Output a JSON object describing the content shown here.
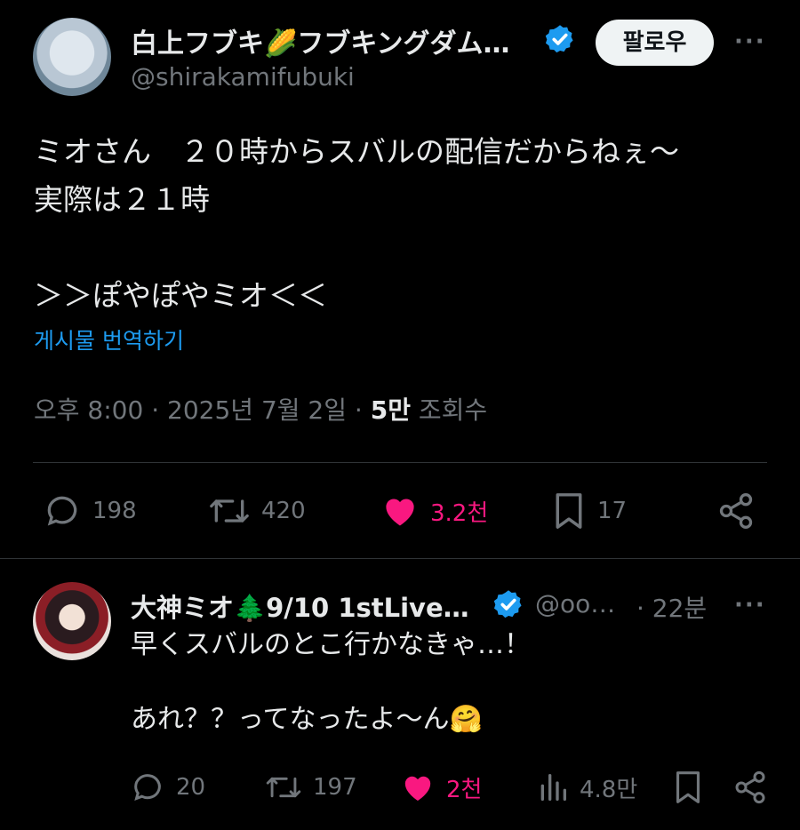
{
  "post": {
    "author_name": "白上フブキ🌽フブキングダム…",
    "handle": "@shirakamifubuki",
    "follow_label": "팔로우",
    "more_label": "···",
    "text": "ミオさん　２０時からスバルの配信だからねぇ～\n実際は２１時\n\n＞＞ぽやぽやミオ＜＜",
    "translate_label": "게시물 번역하기",
    "time": "오후 8:00",
    "separator": "·",
    "date": "2025년 7월 2일",
    "views_count": "5만",
    "views_label": "조회수",
    "stats": {
      "replies": "198",
      "reposts": "420",
      "likes": "3.2천",
      "bookmarks": "17"
    }
  },
  "reply": {
    "author_name": "大神ミオ🌲9/10 1stLive…",
    "handle": "@oo…",
    "time": "· 22분",
    "more_label": "···",
    "text": "早くスバルのとこ行かなきゃ…！\n\nあれ？？ってなったよ～ん🤗",
    "stats": {
      "replies": "20",
      "reposts": "197",
      "likes": "2천",
      "views": "4.8만"
    }
  },
  "colors": {
    "background": "#000000",
    "text": "#e7e9ea",
    "muted": "#71767b",
    "link": "#1d9bf0",
    "like": "#f91880",
    "verified": "#1d9bf0"
  }
}
